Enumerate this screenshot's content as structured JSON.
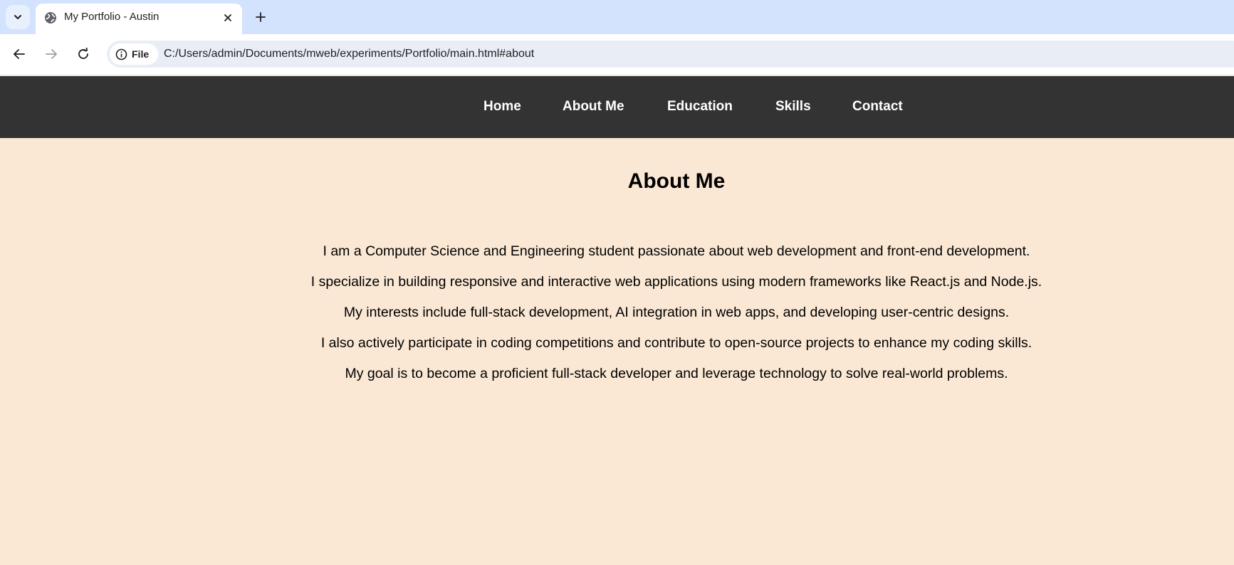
{
  "browser": {
    "tab": {
      "title": "My Portfolio - Austin",
      "favicon": "globe-icon"
    },
    "toolbar": {
      "site_chip_label": "File",
      "url": "C:/Users/admin/Documents/mweb/experiments/Portfolio/main.html#about"
    },
    "colors": {
      "tabstrip": "#d3e3fd",
      "omnibox": "#e9eef6"
    }
  },
  "page": {
    "nav": {
      "items": [
        {
          "label": "Home"
        },
        {
          "label": "About Me"
        },
        {
          "label": "Education"
        },
        {
          "label": "Skills"
        },
        {
          "label": "Contact"
        }
      ]
    },
    "about": {
      "title": "About Me",
      "lines": [
        "I am a Computer Science and Engineering student passionate about web development and front-end development.",
        "I specialize in building responsive and interactive web applications using modern frameworks like React.js and Node.js.",
        "My interests include full-stack development, AI integration in web apps, and developing user-centric designs.",
        "I also actively participate in coding competitions and contribute to open-source projects to enhance my coding skills.",
        "My goal is to become a proficient full-stack developer and leverage technology to solve real-world problems."
      ]
    },
    "colors": {
      "background": "#fae8d4",
      "nav_background": "#333333",
      "nav_text": "#ffffff"
    }
  }
}
